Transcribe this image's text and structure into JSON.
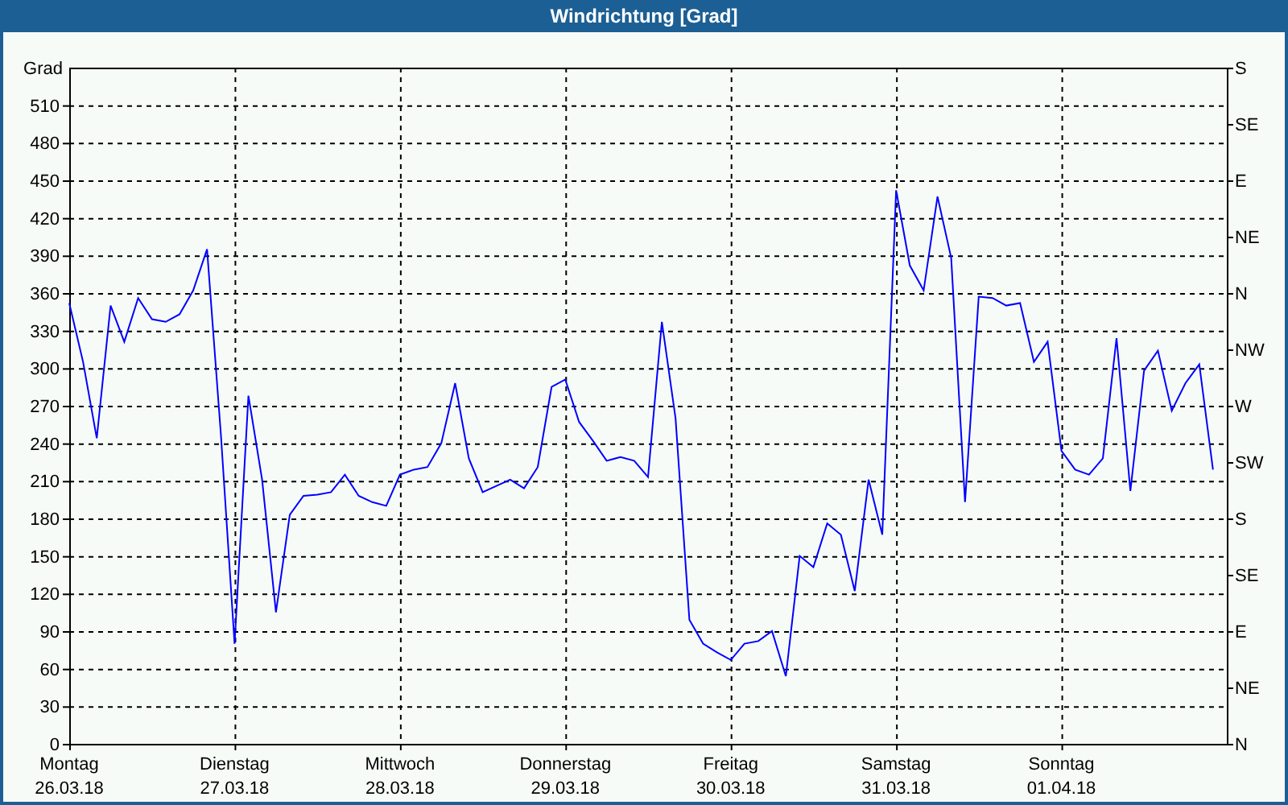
{
  "chart_data": {
    "type": "line",
    "title": "Windrichtung [Grad]",
    "ylabel": "Grad",
    "ylim": [
      0,
      540
    ],
    "grid": true,
    "yticks": [
      0,
      30,
      60,
      90,
      120,
      150,
      180,
      210,
      240,
      270,
      300,
      330,
      360,
      390,
      420,
      450,
      480,
      510
    ],
    "categories": [
      "Montag\n26.03.18",
      null,
      null,
      null,
      null,
      null,
      null,
      null,
      null,
      null,
      null,
      null,
      "Dienstag\n27.03.18",
      null,
      null,
      null,
      null,
      null,
      null,
      null,
      null,
      null,
      null,
      null,
      "Mittwoch\n28.03.18",
      null,
      null,
      null,
      null,
      null,
      null,
      null,
      null,
      null,
      null,
      null,
      "Donnerstag\n29.03.18",
      null,
      null,
      null,
      null,
      null,
      null,
      null,
      null,
      null,
      null,
      null,
      "Freitag\n30.03.18",
      null,
      null,
      null,
      null,
      null,
      null,
      null,
      null,
      null,
      null,
      null,
      "Samstag\n31.03.18",
      null,
      null,
      null,
      null,
      null,
      null,
      null,
      null,
      null,
      null,
      null,
      "Sonntag\n01.04.18",
      null,
      null,
      null,
      null,
      null,
      null,
      null,
      null,
      null,
      null,
      null
    ],
    "series": [
      {
        "color": "#0000ff",
        "values": [
          352,
          305,
          244,
          350,
          321,
          356,
          339,
          337,
          343,
          362,
          395,
          247,
          80,
          278,
          211,
          105,
          183,
          198,
          199,
          201,
          215,
          198,
          193,
          190,
          215,
          219,
          221,
          240,
          288,
          228,
          201,
          206,
          211,
          204,
          221,
          285,
          291,
          257,
          242,
          226,
          229,
          226,
          213,
          337,
          260,
          99,
          80,
          73,
          67,
          80,
          82,
          90,
          54,
          150,
          141,
          176,
          167,
          122,
          211,
          167,
          442,
          382,
          362,
          437,
          388,
          193,
          357,
          356,
          350,
          352,
          305,
          321,
          234,
          219,
          215,
          228,
          324,
          202,
          298,
          314,
          266,
          288,
          303,
          219
        ]
      }
    ]
  },
  "compass_labels": [
    "S",
    "SE",
    "E",
    "NE",
    "N",
    "NW",
    "W",
    "SW",
    "S",
    "SE",
    "E",
    "NE",
    "N"
  ]
}
